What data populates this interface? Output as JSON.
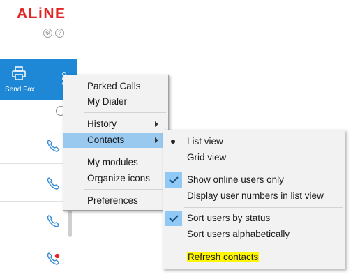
{
  "app": {
    "logo_text": "ALiNE",
    "brand_color": "#e32325",
    "accent_color": "#1e87d6"
  },
  "sidebar": {
    "top_icons": [
      "gear-icon",
      "help-icon"
    ],
    "send_fax_label": "Send Fax",
    "contacts": [
      {
        "icon": "phone-icon"
      },
      {
        "icon": "phone-icon"
      },
      {
        "icon": "phone-icon"
      },
      {
        "icon": "phone-missed-icon"
      }
    ]
  },
  "context_menu": {
    "items": {
      "parked_calls": "Parked Calls",
      "my_dialer": "My Dialer",
      "history": "History",
      "contacts": "Contacts",
      "my_modules": "My modules",
      "organize_icons": "Organize icons",
      "preferences": "Preferences"
    },
    "highlighted": "Contacts"
  },
  "contacts_submenu": {
    "list_view": "List view",
    "grid_view": "Grid view",
    "show_online_only": "Show online users only",
    "display_user_numbers": "Display user numbers in list view",
    "sort_by_status": "Sort users by status",
    "sort_alphabetically": "Sort users alphabetically",
    "refresh_contacts": "Refresh contacts",
    "selected_view": "List view",
    "checked": [
      "Show online users only",
      "Sort users by status"
    ],
    "highlight_color": "#fff700"
  }
}
